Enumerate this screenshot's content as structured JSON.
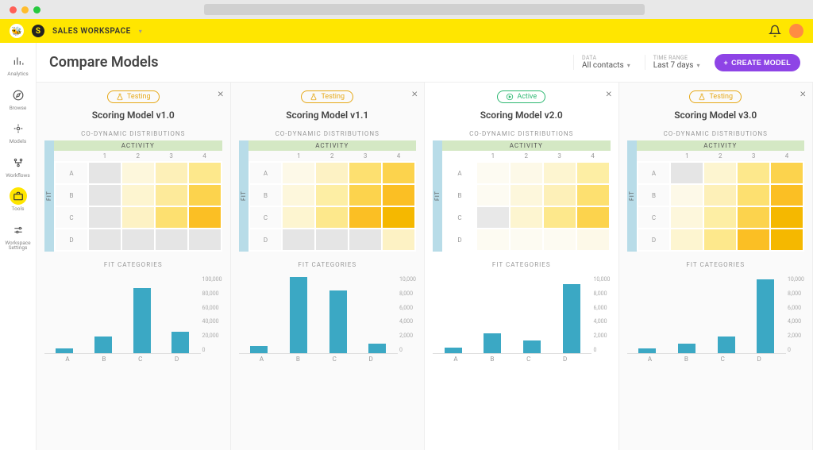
{
  "workspace": {
    "name": "SALES WORKSPACE"
  },
  "sidebar": {
    "items": [
      {
        "label": "Analytics"
      },
      {
        "label": "Browse"
      },
      {
        "label": "Models"
      },
      {
        "label": "Workflows"
      },
      {
        "label": "Tools"
      },
      {
        "label": "Workspace Settings"
      }
    ]
  },
  "header": {
    "title": "Compare Models",
    "data_label": "DATA",
    "data_value": "All contacts",
    "time_label": "TIME RANGE",
    "time_value": "Last 7 days",
    "create_label": "CREATE MODEL"
  },
  "labels": {
    "testing": "Testing",
    "active": "Active",
    "co_dynamic": "CO-DYNAMIC DISTRIBUTIONS",
    "activity": "ACTIVITY",
    "fit": "FIT",
    "fit_categories": "FIT CATEGORIES"
  },
  "heatmap": {
    "col_headers": [
      "1",
      "2",
      "3",
      "4"
    ],
    "row_headers": [
      "A",
      "B",
      "C",
      "D"
    ]
  },
  "models": [
    {
      "name": "Scoring Model v1.0",
      "status": "testing",
      "heatmap": [
        [
          "#e5e5e5",
          "#fdf7dc",
          "#fdf0b8",
          "#fde88c"
        ],
        [
          "#e5e5e5",
          "#fdf5d0",
          "#fdea9a",
          "#fcd34d"
        ],
        [
          "#e5e5e5",
          "#fdf2c4",
          "#fde070",
          "#fbbf24"
        ],
        [
          "#e5e5e5",
          "#e5e5e5",
          "#e5e5e5",
          "#e5e5e5"
        ]
      ]
    },
    {
      "name": "Scoring Model v1.1",
      "status": "testing",
      "heatmap": [
        [
          "#fdf9e8",
          "#fdf2c4",
          "#fde070",
          "#fcd34d"
        ],
        [
          "#fdf7dc",
          "#fdeea4",
          "#fcd34d",
          "#fbbf24"
        ],
        [
          "#fdf5d0",
          "#fde88c",
          "#fbbf24",
          "#f5b800"
        ],
        [
          "#e5e5e5",
          "#e5e5e5",
          "#e5e5e5",
          "#fdf2c4"
        ]
      ]
    },
    {
      "name": "Scoring Model v2.0",
      "status": "active",
      "heatmap": [
        [
          "#fdfbf2",
          "#fdf9e8",
          "#fdf5d0",
          "#fdeea4"
        ],
        [
          "#fdfbf2",
          "#fdf7dc",
          "#fdf0b8",
          "#fde070"
        ],
        [
          "#e8e8e8",
          "#fdf5d0",
          "#fde88c",
          "#fcd34d"
        ],
        [
          "#fdfbf2",
          "#fdfbf2",
          "#fdfbf2",
          "#fdf9e8"
        ]
      ]
    },
    {
      "name": "Scoring Model v3.0",
      "status": "testing",
      "heatmap": [
        [
          "#e5e5e5",
          "#fdf5d0",
          "#fde88c",
          "#fcd34d"
        ],
        [
          "#fdf9e8",
          "#fdf0b8",
          "#fde070",
          "#fbbf24"
        ],
        [
          "#fdf7dc",
          "#fdeea4",
          "#fcd34d",
          "#f5b800"
        ],
        [
          "#fdf5d0",
          "#fde88c",
          "#fbbf24",
          "#f5b800"
        ]
      ]
    }
  ],
  "chart_data": [
    {
      "type": "bar",
      "title": "FIT CATEGORIES",
      "categories": [
        "A",
        "B",
        "C",
        "D"
      ],
      "values": [
        6000,
        22000,
        85000,
        28000
      ],
      "ylim": [
        0,
        100000
      ],
      "yticks": [
        "100,000",
        "80,000",
        "60,000",
        "40,000",
        "20,000",
        "0"
      ],
      "xlabel": "",
      "ylabel": ""
    },
    {
      "type": "bar",
      "title": "FIT CATEGORIES",
      "categories": [
        "A",
        "B",
        "C",
        "D"
      ],
      "values": [
        900,
        9900,
        8100,
        1200
      ],
      "ylim": [
        0,
        10000
      ],
      "yticks": [
        "10,000",
        "8,000",
        "6,000",
        "4,000",
        "2,000",
        "0"
      ],
      "xlabel": "",
      "ylabel": ""
    },
    {
      "type": "bar",
      "title": "FIT CATEGORIES",
      "categories": [
        "A",
        "B",
        "C",
        "D"
      ],
      "values": [
        700,
        2600,
        1600,
        9000
      ],
      "ylim": [
        0,
        10000
      ],
      "yticks": [
        "10,000",
        "8,000",
        "6,000",
        "4,000",
        "2,000",
        "0"
      ],
      "xlabel": "",
      "ylabel": ""
    },
    {
      "type": "bar",
      "title": "FIT CATEGORIES",
      "categories": [
        "A",
        "B",
        "C",
        "D"
      ],
      "values": [
        600,
        1200,
        2200,
        9600
      ],
      "ylim": [
        0,
        10000
      ],
      "yticks": [
        "10,000",
        "8,000",
        "6,000",
        "4,000",
        "2,000",
        "0"
      ],
      "xlabel": "",
      "ylabel": ""
    }
  ]
}
